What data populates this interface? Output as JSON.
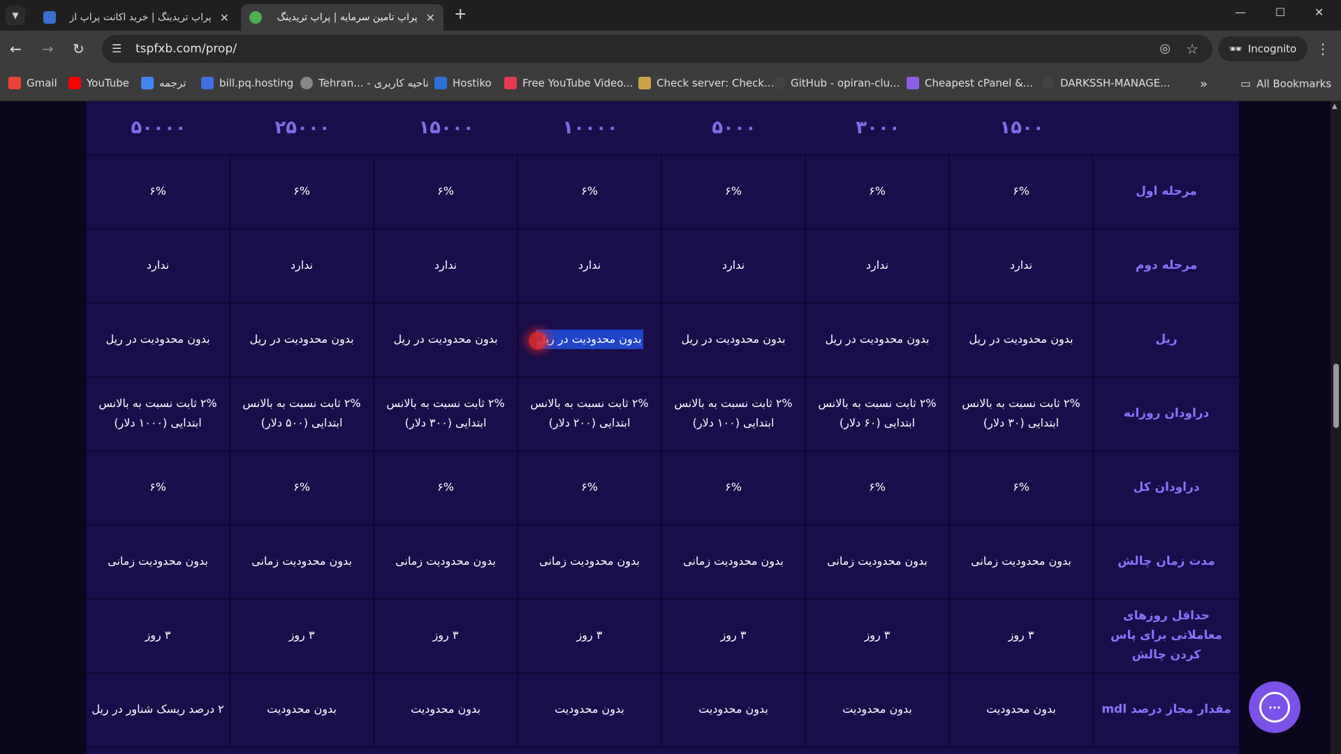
{
  "browser": {
    "tabs": [
      {
        "title": "پراپ تریدینگ | خرید اکانت پراپ از",
        "active": false,
        "favicon_color": "#3b6fd1"
      },
      {
        "title": "پراپ تامین سرمایه | پراپ تریدینگ",
        "active": true,
        "favicon_color": "#4caf50"
      }
    ],
    "url": "tspfxb.com/prop/",
    "incognito_label": "Incognito",
    "bookmarks": [
      {
        "label": "Gmail",
        "color": "#ea4335"
      },
      {
        "label": "YouTube",
        "color": "#ff0000"
      },
      {
        "label": "ترجمه",
        "color": "#4285f4"
      },
      {
        "label": "bill.pq.hosting",
        "color": "#3f6fe0"
      },
      {
        "label": "Tehran... - ناحیه کاربری",
        "color": "#888888"
      },
      {
        "label": "Hostiko",
        "color": "#2f6fd8"
      },
      {
        "label": "Free YouTube Video...",
        "color": "#e53950"
      },
      {
        "label": "Check server: Check...",
        "color": "#c9a24a"
      },
      {
        "label": "GitHub - opiran-clu...",
        "color": "#444444"
      },
      {
        "label": "Cheapest cPanel &...",
        "color": "#8e5de8"
      },
      {
        "label": "DARKSSH-MANAGE...",
        "color": "#444444"
      }
    ],
    "all_bookmarks_label": "All Bookmarks"
  },
  "table": {
    "headers": [
      "۵۰۰۰۰",
      "۲۵۰۰۰",
      "۱۵۰۰۰",
      "۱۰۰۰۰",
      "۵۰۰۰",
      "۳۰۰۰",
      "۱۵۰۰"
    ],
    "rows": [
      {
        "label": "مرحله اول",
        "cells": [
          "۶%",
          "۶%",
          "۶%",
          "۶%",
          "۶%",
          "۶%",
          "۶%"
        ]
      },
      {
        "label": "مرحله دوم",
        "cells": [
          "ندارد",
          "ندارد",
          "ندارد",
          "ندارد",
          "ندارد",
          "ندارد",
          "ندارد"
        ]
      },
      {
        "label": "ریل",
        "cells": [
          "بدون محدودیت در ریل",
          "بدون محدودیت در ریل",
          "بدون محدودیت در ریل",
          "بدون محدودیت در ریل",
          "بدون محدودیت در ریل",
          "بدون محدودیت در ریل",
          "بدون محدودیت در ریل"
        ]
      },
      {
        "label": "دراودان روزانه",
        "cells": [
          "۲% ثابت نسبت به بالانس ابتدایی (۱۰۰۰ دلار)",
          "۲% ثابت نسبت به بالانس ابتدایی (۵۰۰ دلار)",
          "۲% ثابت نسبت به بالانس ابتدایی (۳۰۰ دلار)",
          "۲% ثابت نسبت به بالانس ابتدایی (۲۰۰ دلار)",
          "۲% ثابت نسبت به بالانس ابتدایی (۱۰۰ دلار)",
          "۲% ثابت نسبت به بالانس ابتدایی (۶۰ دلار)",
          "۲% ثابت نسبت به بالانس ابتدایی (۳۰ دلار)"
        ]
      },
      {
        "label": "دراودان کل",
        "cells": [
          "۶%",
          "۶%",
          "۶%",
          "۶%",
          "۶%",
          "۶%",
          "۶%"
        ]
      },
      {
        "label": "مدت زمان چالش",
        "cells": [
          "بدون محدودیت زمانی",
          "بدون محدودیت زمانی",
          "بدون محدودیت زمانی",
          "بدون محدودیت زمانی",
          "بدون محدودیت زمانی",
          "بدون محدودیت زمانی",
          "بدون محدودیت زمانی"
        ]
      },
      {
        "label": "حداقل روزهای معاملاتی برای پاس کردن چالش",
        "cells": [
          "۳ روز",
          "۳ روز",
          "۳ روز",
          "۳ روز",
          "۳ روز",
          "۳ روز",
          "۳ روز"
        ]
      },
      {
        "label": "مقدار مجاز درصد mdl",
        "cells": [
          "۲ درصد ریسک شناور در ریل",
          "بدون محدودیت",
          "بدون محدودیت",
          "بدون محدودیت",
          "بدون محدودیت",
          "بدون محدودیت",
          "بدون محدودیت"
        ]
      }
    ]
  }
}
